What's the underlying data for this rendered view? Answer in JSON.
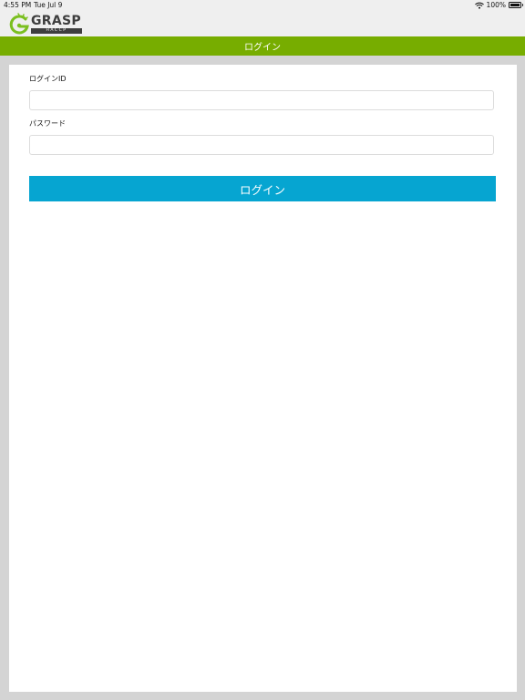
{
  "status_bar": {
    "time": "4:55 PM",
    "date": "Tue Jul 9",
    "battery": "100%",
    "icons": [
      "wifi-icon",
      "battery-icon"
    ]
  },
  "app": {
    "logo_text": "GRASP",
    "logo_sub": "HACCP"
  },
  "header": {
    "title": "ログイン"
  },
  "form": {
    "login_id_label": "ログインID",
    "login_id_value": "",
    "password_label": "パスワード",
    "password_value": "",
    "submit_label": "ログイン"
  },
  "colors": {
    "header_green": "#77ad00",
    "button_blue": "#06a5d1",
    "logo_green": "#7bbf20"
  }
}
